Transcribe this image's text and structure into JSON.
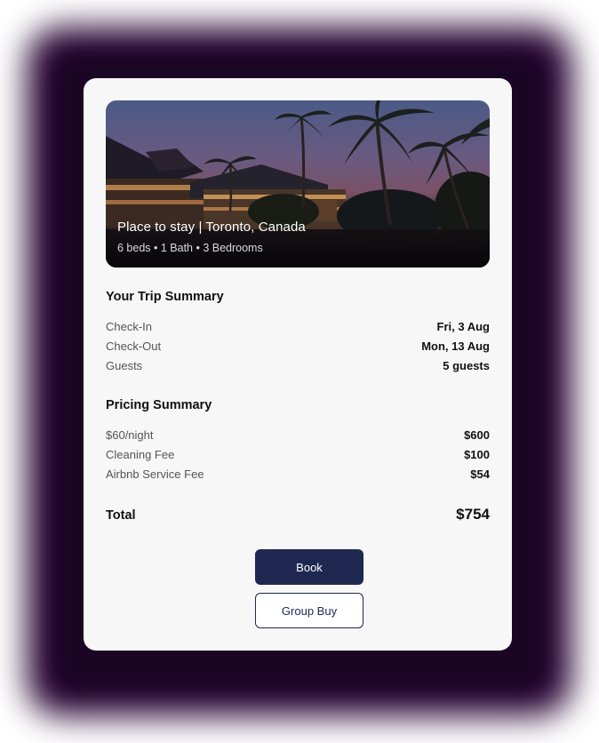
{
  "listing": {
    "title": "Place to stay | Toronto, Canada",
    "details": "6 beds • 1 Bath • 3 Bedrooms"
  },
  "trip_summary": {
    "title": "Your Trip Summary",
    "rows": [
      {
        "label": "Check-In",
        "value": "Fri, 3 Aug"
      },
      {
        "label": "Check-Out",
        "value": "Mon, 13 Aug"
      },
      {
        "label": "Guests",
        "value": "5 guests"
      }
    ]
  },
  "pricing_summary": {
    "title": "Pricing Summary",
    "rows": [
      {
        "label": "$60/night",
        "value": "$600"
      },
      {
        "label": "Cleaning Fee",
        "value": "$100"
      },
      {
        "label": "Airbnb Service Fee",
        "value": "$54"
      }
    ]
  },
  "total": {
    "label": "Total",
    "value": "$754"
  },
  "actions": {
    "book_label": "Book",
    "group_buy_label": "Group Buy"
  },
  "colors": {
    "primary": "#1f2850",
    "backdrop": "#2a0636",
    "card": "#f7f7f8"
  }
}
